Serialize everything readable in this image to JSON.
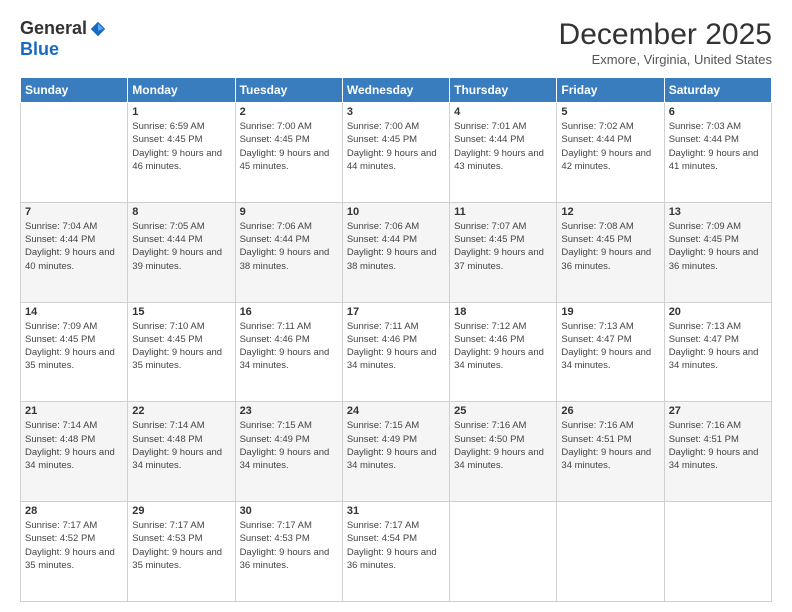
{
  "logo": {
    "general": "General",
    "blue": "Blue"
  },
  "header": {
    "month": "December 2025",
    "location": "Exmore, Virginia, United States"
  },
  "weekdays": [
    "Sunday",
    "Monday",
    "Tuesday",
    "Wednesday",
    "Thursday",
    "Friday",
    "Saturday"
  ],
  "weeks": [
    [
      {
        "day": "",
        "info": ""
      },
      {
        "day": "1",
        "info": "Sunrise: 6:59 AM\nSunset: 4:45 PM\nDaylight: 9 hours and 46 minutes."
      },
      {
        "day": "2",
        "info": "Sunrise: 7:00 AM\nSunset: 4:45 PM\nDaylight: 9 hours and 45 minutes."
      },
      {
        "day": "3",
        "info": "Sunrise: 7:00 AM\nSunset: 4:45 PM\nDaylight: 9 hours and 44 minutes."
      },
      {
        "day": "4",
        "info": "Sunrise: 7:01 AM\nSunset: 4:44 PM\nDaylight: 9 hours and 43 minutes."
      },
      {
        "day": "5",
        "info": "Sunrise: 7:02 AM\nSunset: 4:44 PM\nDaylight: 9 hours and 42 minutes."
      },
      {
        "day": "6",
        "info": "Sunrise: 7:03 AM\nSunset: 4:44 PM\nDaylight: 9 hours and 41 minutes."
      }
    ],
    [
      {
        "day": "7",
        "info": "Sunrise: 7:04 AM\nSunset: 4:44 PM\nDaylight: 9 hours and 40 minutes."
      },
      {
        "day": "8",
        "info": "Sunrise: 7:05 AM\nSunset: 4:44 PM\nDaylight: 9 hours and 39 minutes."
      },
      {
        "day": "9",
        "info": "Sunrise: 7:06 AM\nSunset: 4:44 PM\nDaylight: 9 hours and 38 minutes."
      },
      {
        "day": "10",
        "info": "Sunrise: 7:06 AM\nSunset: 4:44 PM\nDaylight: 9 hours and 38 minutes."
      },
      {
        "day": "11",
        "info": "Sunrise: 7:07 AM\nSunset: 4:45 PM\nDaylight: 9 hours and 37 minutes."
      },
      {
        "day": "12",
        "info": "Sunrise: 7:08 AM\nSunset: 4:45 PM\nDaylight: 9 hours and 36 minutes."
      },
      {
        "day": "13",
        "info": "Sunrise: 7:09 AM\nSunset: 4:45 PM\nDaylight: 9 hours and 36 minutes."
      }
    ],
    [
      {
        "day": "14",
        "info": "Sunrise: 7:09 AM\nSunset: 4:45 PM\nDaylight: 9 hours and 35 minutes."
      },
      {
        "day": "15",
        "info": "Sunrise: 7:10 AM\nSunset: 4:45 PM\nDaylight: 9 hours and 35 minutes."
      },
      {
        "day": "16",
        "info": "Sunrise: 7:11 AM\nSunset: 4:46 PM\nDaylight: 9 hours and 34 minutes."
      },
      {
        "day": "17",
        "info": "Sunrise: 7:11 AM\nSunset: 4:46 PM\nDaylight: 9 hours and 34 minutes."
      },
      {
        "day": "18",
        "info": "Sunrise: 7:12 AM\nSunset: 4:46 PM\nDaylight: 9 hours and 34 minutes."
      },
      {
        "day": "19",
        "info": "Sunrise: 7:13 AM\nSunset: 4:47 PM\nDaylight: 9 hours and 34 minutes."
      },
      {
        "day": "20",
        "info": "Sunrise: 7:13 AM\nSunset: 4:47 PM\nDaylight: 9 hours and 34 minutes."
      }
    ],
    [
      {
        "day": "21",
        "info": "Sunrise: 7:14 AM\nSunset: 4:48 PM\nDaylight: 9 hours and 34 minutes."
      },
      {
        "day": "22",
        "info": "Sunrise: 7:14 AM\nSunset: 4:48 PM\nDaylight: 9 hours and 34 minutes."
      },
      {
        "day": "23",
        "info": "Sunrise: 7:15 AM\nSunset: 4:49 PM\nDaylight: 9 hours and 34 minutes."
      },
      {
        "day": "24",
        "info": "Sunrise: 7:15 AM\nSunset: 4:49 PM\nDaylight: 9 hours and 34 minutes."
      },
      {
        "day": "25",
        "info": "Sunrise: 7:16 AM\nSunset: 4:50 PM\nDaylight: 9 hours and 34 minutes."
      },
      {
        "day": "26",
        "info": "Sunrise: 7:16 AM\nSunset: 4:51 PM\nDaylight: 9 hours and 34 minutes."
      },
      {
        "day": "27",
        "info": "Sunrise: 7:16 AM\nSunset: 4:51 PM\nDaylight: 9 hours and 34 minutes."
      }
    ],
    [
      {
        "day": "28",
        "info": "Sunrise: 7:17 AM\nSunset: 4:52 PM\nDaylight: 9 hours and 35 minutes."
      },
      {
        "day": "29",
        "info": "Sunrise: 7:17 AM\nSunset: 4:53 PM\nDaylight: 9 hours and 35 minutes."
      },
      {
        "day": "30",
        "info": "Sunrise: 7:17 AM\nSunset: 4:53 PM\nDaylight: 9 hours and 36 minutes."
      },
      {
        "day": "31",
        "info": "Sunrise: 7:17 AM\nSunset: 4:54 PM\nDaylight: 9 hours and 36 minutes."
      },
      {
        "day": "",
        "info": ""
      },
      {
        "day": "",
        "info": ""
      },
      {
        "day": "",
        "info": ""
      }
    ]
  ]
}
